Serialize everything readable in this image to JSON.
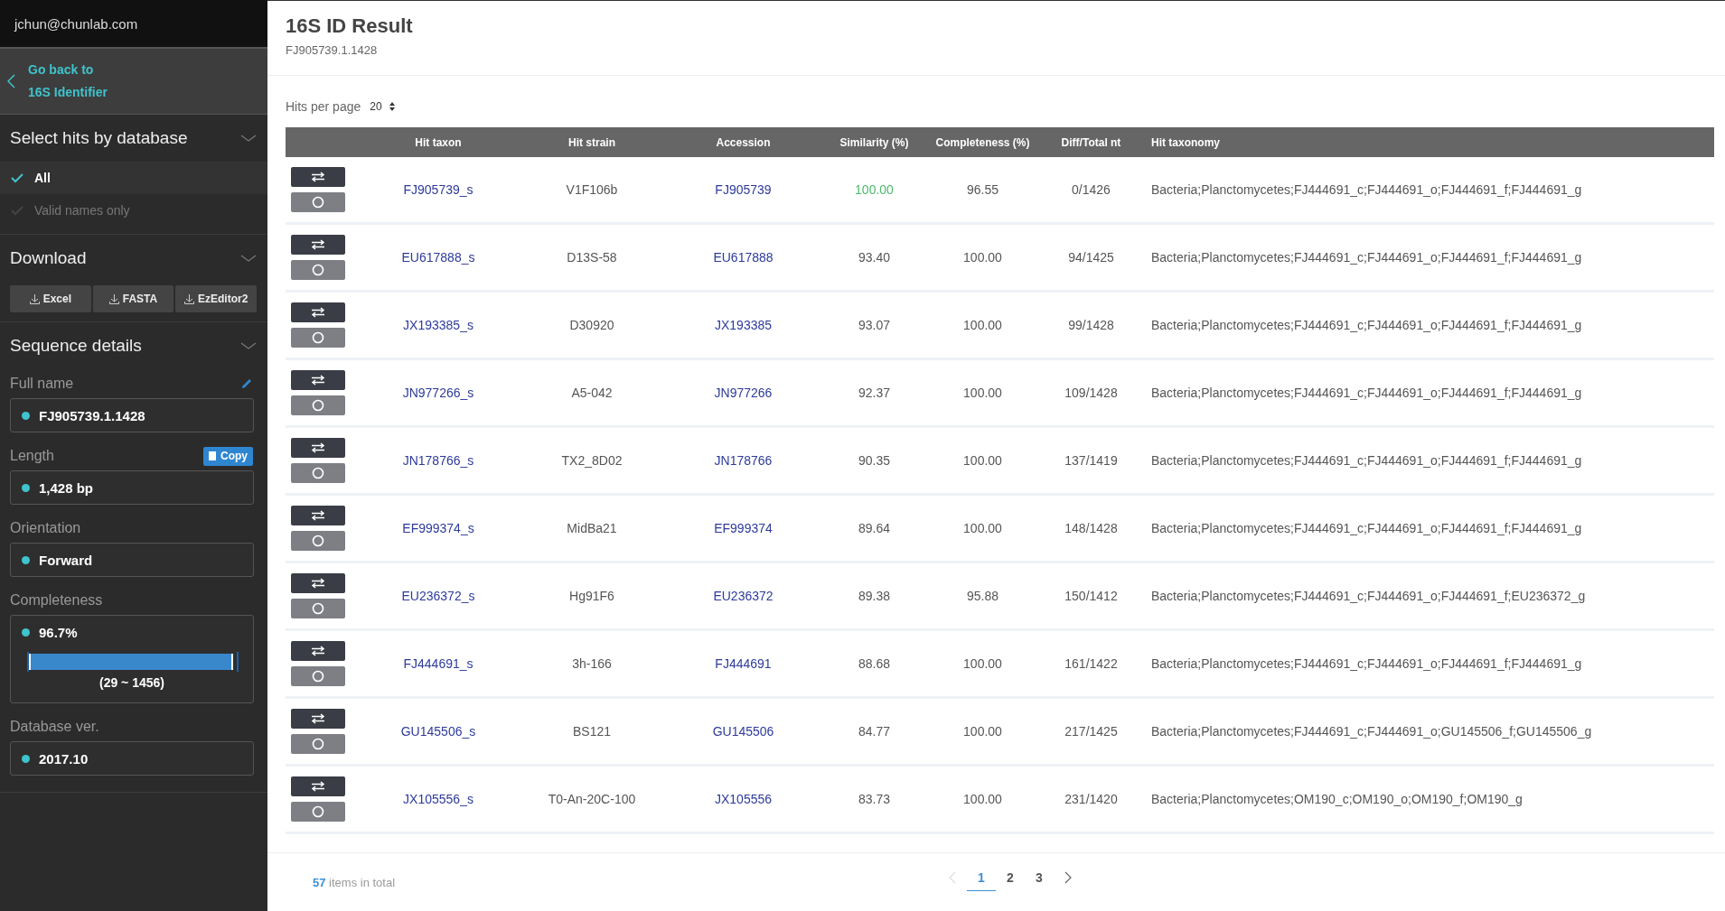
{
  "sidebar": {
    "user_email": "jchun@chunlab.com",
    "back_link": {
      "line_1": "Go back to",
      "line_2": "16S Identifier"
    },
    "sections": [
      {
        "kind": "filter",
        "title": "Select hits by database",
        "options": [
          {
            "label": "All",
            "checked": true
          },
          {
            "label": "Valid names only",
            "checked": false
          }
        ]
      },
      {
        "kind": "download",
        "title": "Download",
        "buttons": [
          "Excel",
          "FASTA",
          "EzEditor2"
        ]
      },
      {
        "kind": "details",
        "title": "Sequence details",
        "fields": [
          {
            "kind": "text",
            "label": "Full name",
            "value": "FJ905739.1.1428",
            "editable": true
          },
          {
            "kind": "text",
            "label": "Length",
            "value": "1,428 bp",
            "editable": false,
            "copy_label": "Copy"
          },
          {
            "kind": "text",
            "label": "Orientation",
            "value": "Forward"
          },
          {
            "kind": "range",
            "label": "Completeness",
            "value": "96.7%",
            "level": 0.967,
            "range": "(29 ~ 1456)"
          },
          {
            "kind": "text",
            "label": "Database ver.",
            "value": "2017.10"
          }
        ]
      }
    ]
  },
  "main": {
    "title": "16S ID Result",
    "subtitle": "FJ905739.1.1428",
    "hits_per_page": {
      "label": "Hits per page",
      "value": "20"
    },
    "table": {
      "columns": [
        "Hit taxon",
        "Hit strain",
        "Accession",
        "Similarity (%)",
        "Completeness (%)",
        "Diff/Total nt",
        "Hit taxonomy"
      ],
      "rows": [
        {
          "taxon": "FJ905739_s",
          "strain": "V1F106b",
          "accession": "FJ905739",
          "similarity": "100.00",
          "top_hit": true,
          "completeness": "96.55",
          "diff": "0/1426",
          "taxonomy": "Bacteria;Planctomycetes;FJ444691_c;FJ444691_o;FJ444691_f;FJ444691_g"
        },
        {
          "taxon": "EU617888_s",
          "strain": "D13S-58",
          "accession": "EU617888",
          "similarity": "93.40",
          "top_hit": false,
          "completeness": "100.00",
          "diff": "94/1425",
          "taxonomy": "Bacteria;Planctomycetes;FJ444691_c;FJ444691_o;FJ444691_f;FJ444691_g"
        },
        {
          "taxon": "JX193385_s",
          "strain": "D30920",
          "accession": "JX193385",
          "similarity": "93.07",
          "top_hit": false,
          "completeness": "100.00",
          "diff": "99/1428",
          "taxonomy": "Bacteria;Planctomycetes;FJ444691_c;FJ444691_o;FJ444691_f;FJ444691_g"
        },
        {
          "taxon": "JN977266_s",
          "strain": "A5-042",
          "accession": "JN977266",
          "similarity": "92.37",
          "top_hit": false,
          "completeness": "100.00",
          "diff": "109/1428",
          "taxonomy": "Bacteria;Planctomycetes;FJ444691_c;FJ444691_o;FJ444691_f;FJ444691_g"
        },
        {
          "taxon": "JN178766_s",
          "strain": "TX2_8D02",
          "accession": "JN178766",
          "similarity": "90.35",
          "top_hit": false,
          "completeness": "100.00",
          "diff": "137/1419",
          "taxonomy": "Bacteria;Planctomycetes;FJ444691_c;FJ444691_o;FJ444691_f;FJ444691_g"
        },
        {
          "taxon": "EF999374_s",
          "strain": "MidBa21",
          "accession": "EF999374",
          "similarity": "89.64",
          "top_hit": false,
          "completeness": "100.00",
          "diff": "148/1428",
          "taxonomy": "Bacteria;Planctomycetes;FJ444691_c;FJ444691_o;FJ444691_f;FJ444691_g"
        },
        {
          "taxon": "EU236372_s",
          "strain": "Hg91F6",
          "accession": "EU236372",
          "similarity": "89.38",
          "top_hit": false,
          "completeness": "95.88",
          "diff": "150/1412",
          "taxonomy": "Bacteria;Planctomycetes;FJ444691_c;FJ444691_o;FJ444691_f;EU236372_g"
        },
        {
          "taxon": "FJ444691_s",
          "strain": "3h-166",
          "accession": "FJ444691",
          "similarity": "88.68",
          "top_hit": false,
          "completeness": "100.00",
          "diff": "161/1422",
          "taxonomy": "Bacteria;Planctomycetes;FJ444691_c;FJ444691_o;FJ444691_f;FJ444691_g"
        },
        {
          "taxon": "GU145506_s",
          "strain": "BS121",
          "accession": "GU145506",
          "similarity": "84.77",
          "top_hit": false,
          "completeness": "100.00",
          "diff": "217/1425",
          "taxonomy": "Bacteria;Planctomycetes;FJ444691_c;FJ444691_o;GU145506_f;GU145506_g"
        },
        {
          "taxon": "JX105556_s",
          "strain": "T0-An-20C-100",
          "accession": "JX105556",
          "similarity": "83.73",
          "top_hit": false,
          "completeness": "100.00",
          "diff": "231/1420",
          "taxonomy": "Bacteria;Planctomycetes;OM190_c;OM190_o;OM190_f;OM190_g"
        }
      ]
    },
    "footer": {
      "total_count": "57",
      "total_label": "items in total",
      "pagination": {
        "prev_disabled": true,
        "next_disabled": false,
        "pages": [
          {
            "label": "1",
            "selected": true
          },
          {
            "label": "2",
            "selected": false
          },
          {
            "label": "3",
            "selected": false
          }
        ]
      }
    }
  }
}
